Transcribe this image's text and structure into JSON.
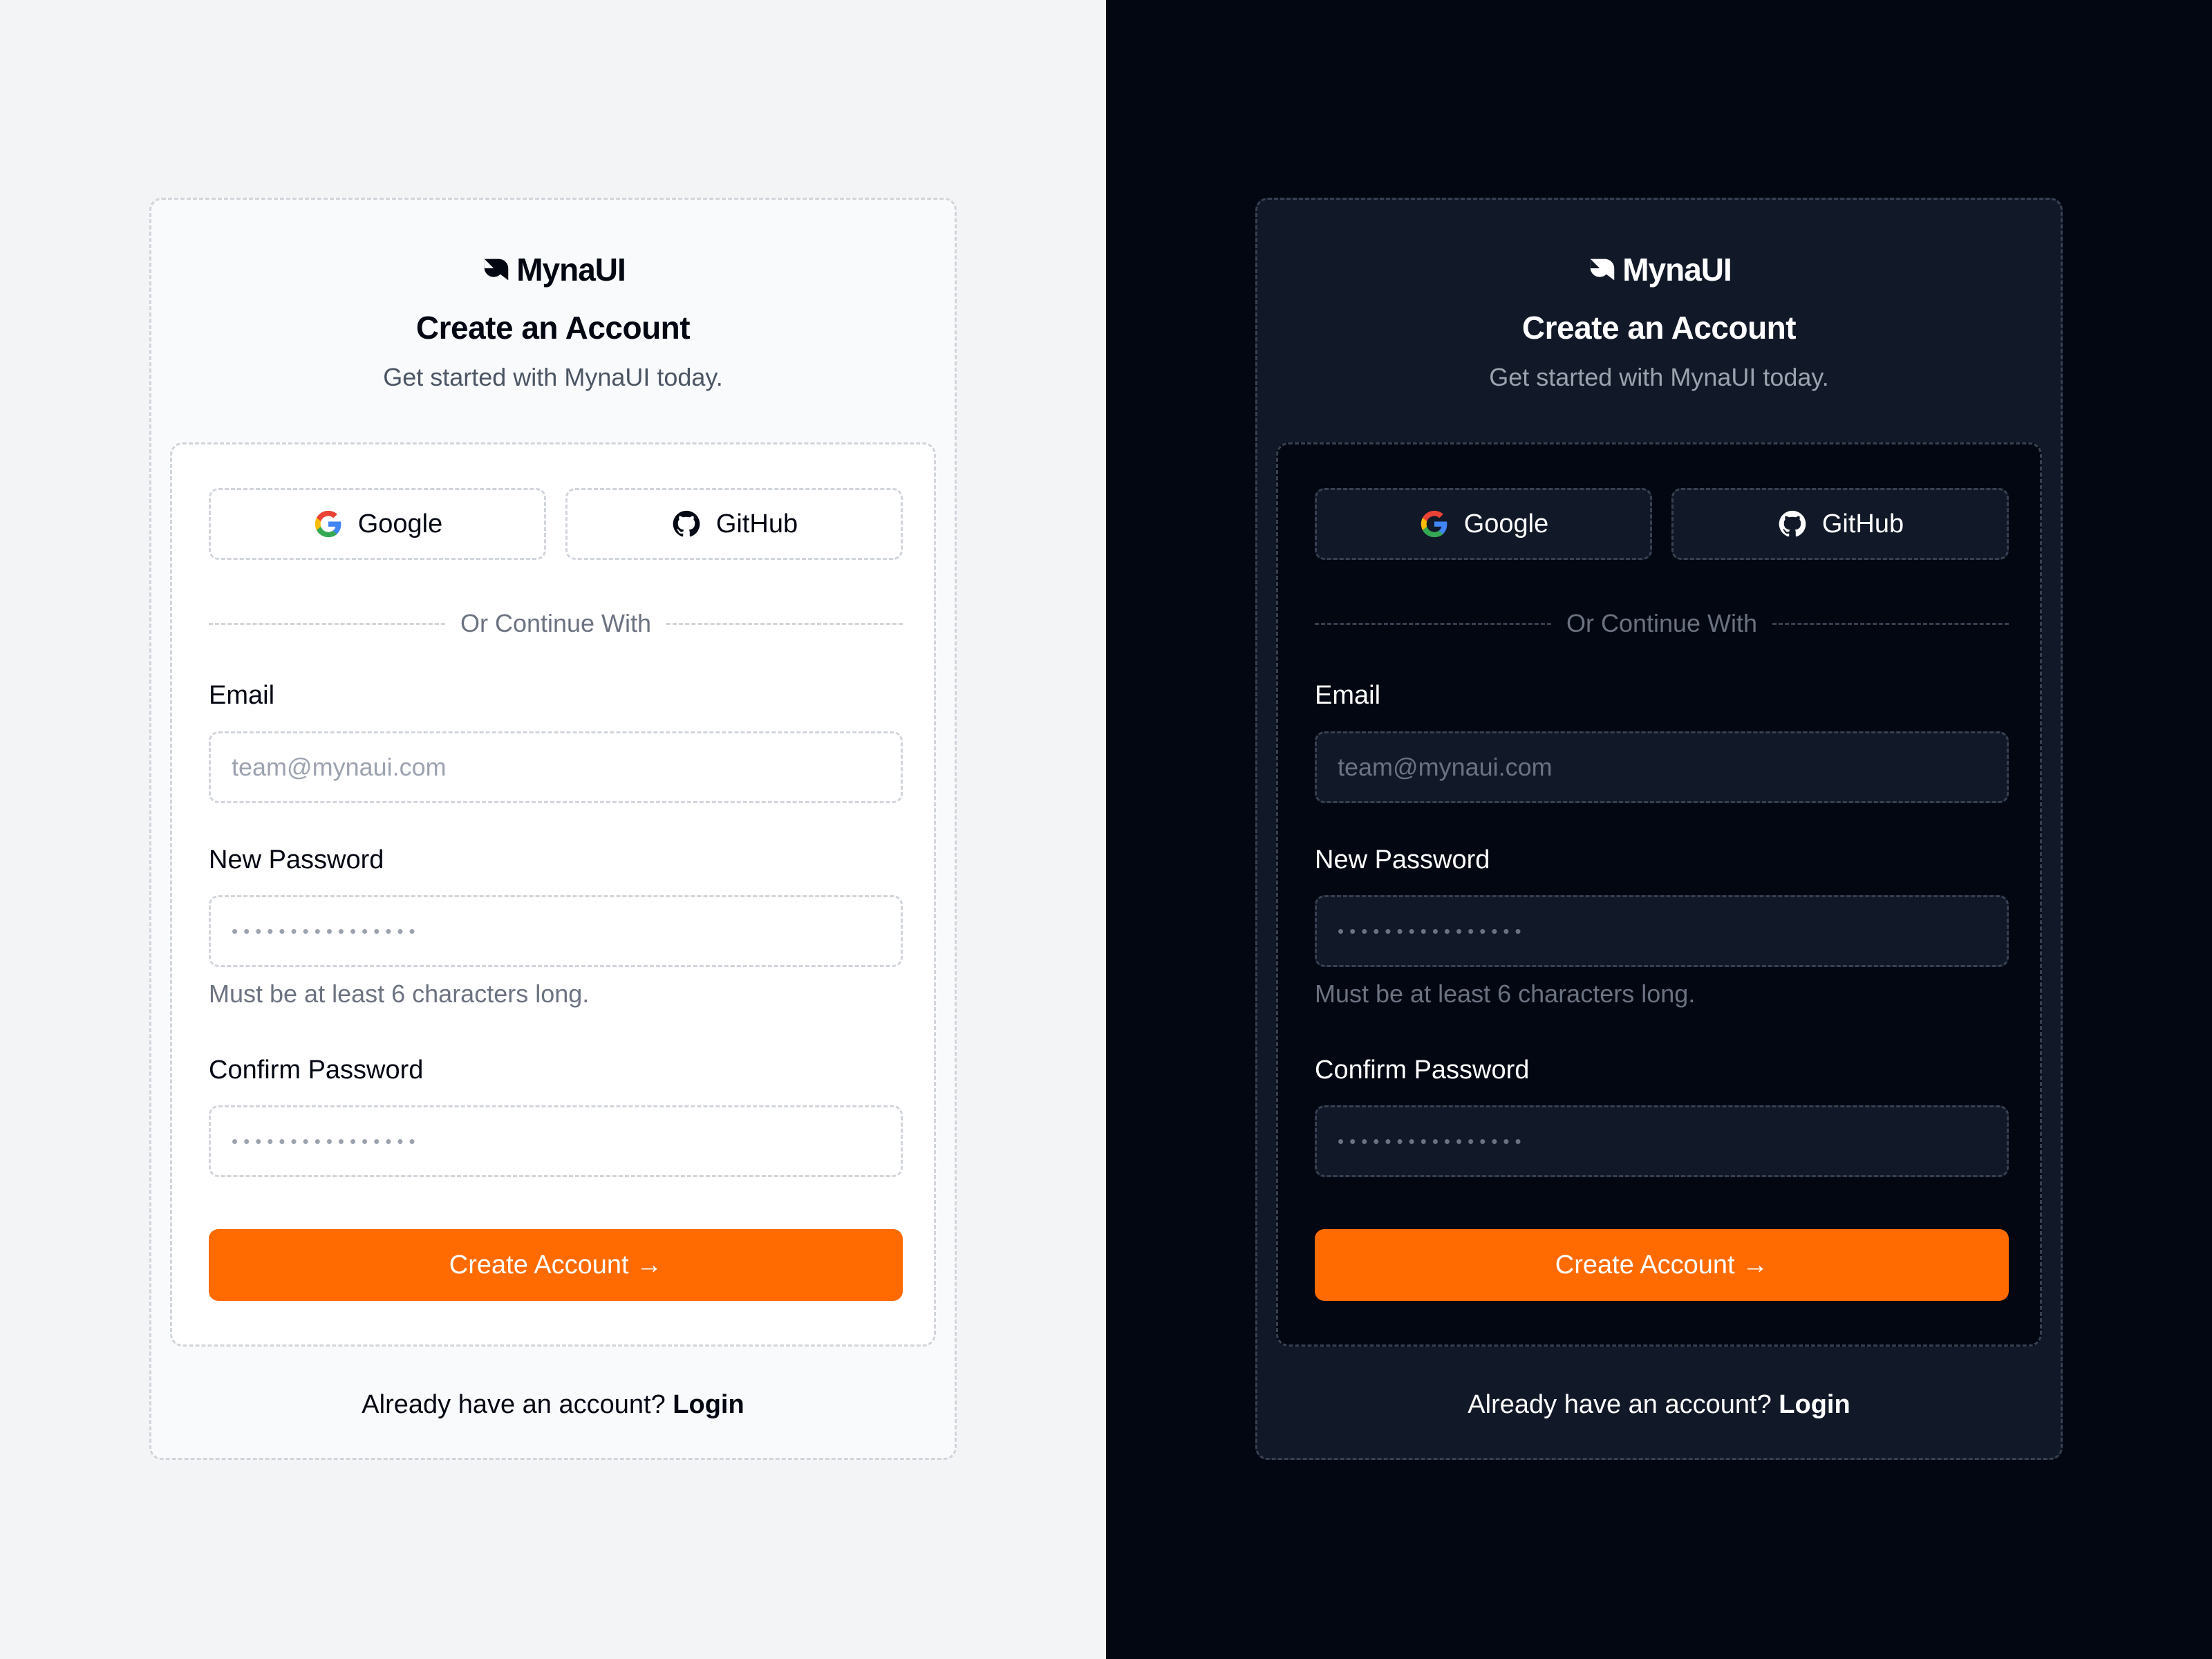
{
  "brand": {
    "name": "MynaUI",
    "accent_color": "#FF6B00"
  },
  "panels": [
    {
      "theme": "light",
      "background": "#F3F4F6",
      "logo_text": "MynaUI",
      "title": "Create an Account",
      "subtitle": "Get started with MynaUI today.",
      "oauth": {
        "google_label": "Google",
        "github_label": "GitHub"
      },
      "divider_text": "Or Continue With",
      "email": {
        "label": "Email",
        "placeholder": "team@mynaui.com"
      },
      "new_password": {
        "label": "New Password",
        "value": "••••••••••••••••",
        "hint": "Must be at least 6 characters long."
      },
      "confirm_password": {
        "label": "Confirm Password",
        "value": "••••••••••••••••"
      },
      "submit_label": "Create Account →",
      "footer_text": "Already have an account?",
      "footer_link": "Login"
    },
    {
      "theme": "dark",
      "background": "#030712",
      "logo_text": "MynaUI",
      "title": "Create an Account",
      "subtitle": "Get started with MynaUI today.",
      "oauth": {
        "google_label": "Google",
        "github_label": "GitHub"
      },
      "divider_text": "Or Continue With",
      "email": {
        "label": "Email",
        "placeholder": "team@mynaui.com"
      },
      "new_password": {
        "label": "New Password",
        "value": "••••••••••••••••",
        "hint": "Must be at least 6 characters long."
      },
      "confirm_password": {
        "label": "Confirm Password",
        "value": "••••••••••••••••"
      },
      "submit_label": "Create Account →",
      "footer_text": "Already have an account?",
      "footer_link": "Login"
    }
  ]
}
